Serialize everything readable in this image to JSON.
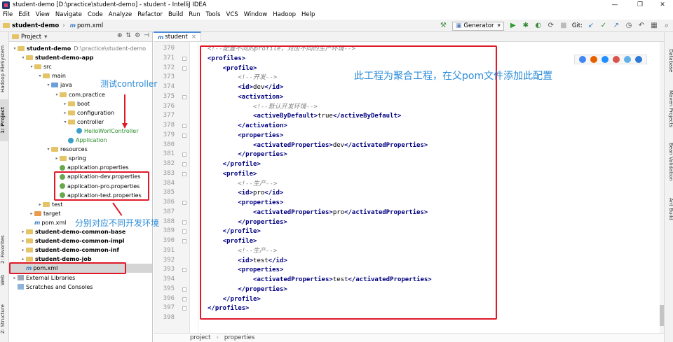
{
  "window": {
    "title": "student-demo [D:\\practice\\student-demo] - student - IntelliJ IDEA",
    "controls": [
      "—",
      "❐",
      "✕"
    ]
  },
  "menu": [
    "File",
    "Edit",
    "View",
    "Navigate",
    "Code",
    "Analyze",
    "Refactor",
    "Build",
    "Run",
    "Tools",
    "VCS",
    "Window",
    "Hadoop",
    "Help"
  ],
  "breadcrumb": {
    "project": "student-demo",
    "file": "pom.xml"
  },
  "toolbar": {
    "run_config": "Generator",
    "git_label": "Git:"
  },
  "project_panel": {
    "title": "Project",
    "rows": [
      {
        "label": "student-demo",
        "extra": "D:\\practice\\student-demo"
      },
      {
        "label": "student-demo-app"
      },
      {
        "label": "src"
      },
      {
        "label": "main"
      },
      {
        "label": "java"
      },
      {
        "label": "com.practice"
      },
      {
        "label": "boot"
      },
      {
        "label": "configuration"
      },
      {
        "label": "controller"
      },
      {
        "label": "HelloWorlController"
      },
      {
        "label": "Application"
      },
      {
        "label": "resources"
      },
      {
        "label": "spring"
      },
      {
        "label": "application.properties"
      },
      {
        "label": "application-dev.properties"
      },
      {
        "label": "application-pro.properties"
      },
      {
        "label": "application-test.properties"
      },
      {
        "label": "test"
      },
      {
        "label": "target"
      },
      {
        "label": "pom.xml"
      },
      {
        "label": "student-demo-common-base"
      },
      {
        "label": "student-demo-common-impl"
      },
      {
        "label": "student-demo-common-inf"
      },
      {
        "label": "student-demo-job"
      },
      {
        "label": "pom.xml"
      },
      {
        "label": "External Libraries"
      },
      {
        "label": "Scratches and Consoles"
      }
    ]
  },
  "left_strip": [
    "Hadoop FileSystem",
    "1: Project",
    "2: Favorites",
    "Web",
    "Z: Structure"
  ],
  "right_strip": [
    "Database",
    "Maven Projects",
    "Bean Validation",
    "Ant Build"
  ],
  "editor": {
    "tab": "student",
    "line_numbers": [
      "370",
      "371",
      "372",
      "373",
      "374",
      "375",
      "376",
      "377",
      "378",
      "379",
      "380",
      "381",
      "382",
      "383",
      "384",
      "385",
      "386",
      "387",
      "388",
      "389",
      "390",
      "391",
      "392",
      "393",
      "394",
      "395",
      "396",
      "397",
      "398"
    ],
    "lines": [
      {
        "t": "cmt",
        "text": "<!--配置不同的profile，对应不同的生产环境-->"
      },
      {
        "t": "tag",
        "text": "<profiles>"
      },
      {
        "t": "tag",
        "text": "    <profile>"
      },
      {
        "t": "cmt",
        "text": "        <!--开发-->"
      },
      {
        "t": "mix",
        "open": "        <id>",
        "val": "dev",
        "close": "</id>"
      },
      {
        "t": "tag",
        "text": "        <activation>"
      },
      {
        "t": "cmt",
        "text": "            <!--默认开发环境-->"
      },
      {
        "t": "mix",
        "open": "            <activeByDefault>",
        "val": "true",
        "close": "</activeByDefault>"
      },
      {
        "t": "tag",
        "text": "        </activation>"
      },
      {
        "t": "tag",
        "text": "        <properties>"
      },
      {
        "t": "mix",
        "open": "            <activatedProperties>",
        "val": "dev",
        "close": "</activatedProperties>"
      },
      {
        "t": "tag",
        "text": "        </properties>"
      },
      {
        "t": "tag",
        "text": "    </profile>"
      },
      {
        "t": "tag",
        "text": "    <profile>"
      },
      {
        "t": "cmt",
        "text": "        <!--生产-->"
      },
      {
        "t": "mix",
        "open": "        <id>",
        "val": "pro",
        "close": "</id>"
      },
      {
        "t": "tag",
        "text": "        <properties>"
      },
      {
        "t": "mix",
        "open": "            <activatedProperties>",
        "val": "pro",
        "close": "</activatedProperties>"
      },
      {
        "t": "tag",
        "text": "        </properties>"
      },
      {
        "t": "tag",
        "text": "    </profile>"
      },
      {
        "t": "tag",
        "text": "    <profile>"
      },
      {
        "t": "cmt",
        "text": "        <!--生产-->"
      },
      {
        "t": "mix",
        "open": "        <id>",
        "val": "test",
        "close": "</id>"
      },
      {
        "t": "tag",
        "text": "        <properties>"
      },
      {
        "t": "mix",
        "open": "            <activatedProperties>",
        "val": "test",
        "close": "</activatedProperties>"
      },
      {
        "t": "tag",
        "text": "        </properties>"
      },
      {
        "t": "tag",
        "text": "    </profile>"
      },
      {
        "t": "tag",
        "text": "</profiles>"
      },
      {
        "t": "txt",
        "text": ""
      }
    ],
    "status_crumbs": [
      "project",
      "properties"
    ]
  },
  "annotations": {
    "controller_note": "测试controller",
    "env_note": "分别对应不同开发环境",
    "aggregate_note": "此工程为聚合工程，在父pom文件添加此配置"
  },
  "colors": {
    "annotation_red": "#e0192a",
    "annotation_blue": "#2b8bd9",
    "xml_tag": "#000080",
    "comment": "#808080"
  }
}
